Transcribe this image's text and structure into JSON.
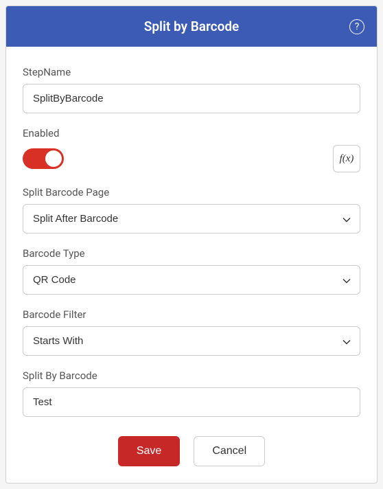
{
  "header": {
    "title": "Split by Barcode",
    "help_glyph": "?"
  },
  "fields": {
    "stepName": {
      "label": "StepName",
      "value": "SplitByBarcode"
    },
    "enabled": {
      "label": "Enabled",
      "fx_label": "f(x)"
    },
    "splitBarcodePage": {
      "label": "Split Barcode Page",
      "value": "Split After Barcode"
    },
    "barcodeType": {
      "label": "Barcode Type",
      "value": "QR Code"
    },
    "barcodeFilter": {
      "label": "Barcode Filter",
      "value": "Starts With"
    },
    "splitByBarcode": {
      "label": "Split By Barcode",
      "value": "Test"
    }
  },
  "buttons": {
    "save": "Save",
    "cancel": "Cancel"
  }
}
